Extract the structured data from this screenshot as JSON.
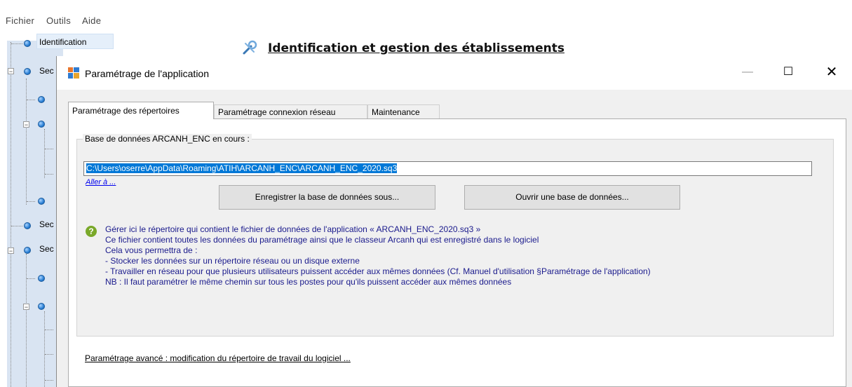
{
  "menubar": {
    "items": [
      "Fichier",
      "Outils",
      "Aide"
    ]
  },
  "tree": {
    "selected_label": "Identification",
    "partial_labels": [
      "Sec",
      "Sec",
      "Sec"
    ]
  },
  "background": {
    "title": "Identification et gestion des établissements"
  },
  "dialog": {
    "title": "Paramétrage de l'application",
    "tabs": [
      "Paramétrage des répertoires",
      "Paramétrage connexion réseau",
      "Maintenance"
    ],
    "group_label": "Base de données ARCANH_ENC en cours :",
    "path_value": "C:\\Users\\oserre\\AppData\\Roaming\\ATIH\\ARCANH_ENC\\ARCANH_ENC_2020.sq3",
    "goto_link": "Aller à ...",
    "save_button": "Enregistrer la base de données sous...",
    "open_button": "Ouvrir une base de données...",
    "info": [
      "Gérer ici le répertoire qui contient le fichier de données de l'application « ARCANH_ENC_2020.sq3 »",
      "Ce fichier contient toutes les données du paramétrage ainsi que le classeur Arcanh qui est enregistré dans le logiciel",
      "Cela vous permettra de :",
      " - Stocker les données sur un répertoire réseau ou un disque externe",
      " - Travailler en réseau pour que plusieurs utilisateurs puissent accéder aux mêmes données (Cf. Manuel d'utilisation §Paramétrage de l'application)",
      "NB : Il faut paramétrer le même chemin sur tous les postes pour qu'ils puissent accéder aux mêmes données"
    ],
    "advanced_link": "Paramétrage avancé : modification du répertoire de travail du logiciel ..."
  },
  "colors": {
    "selection": "#0078d7",
    "info_text": "#1a1a8c",
    "help_icon": "#79a829",
    "tree_bg": "#d9e4f2"
  }
}
